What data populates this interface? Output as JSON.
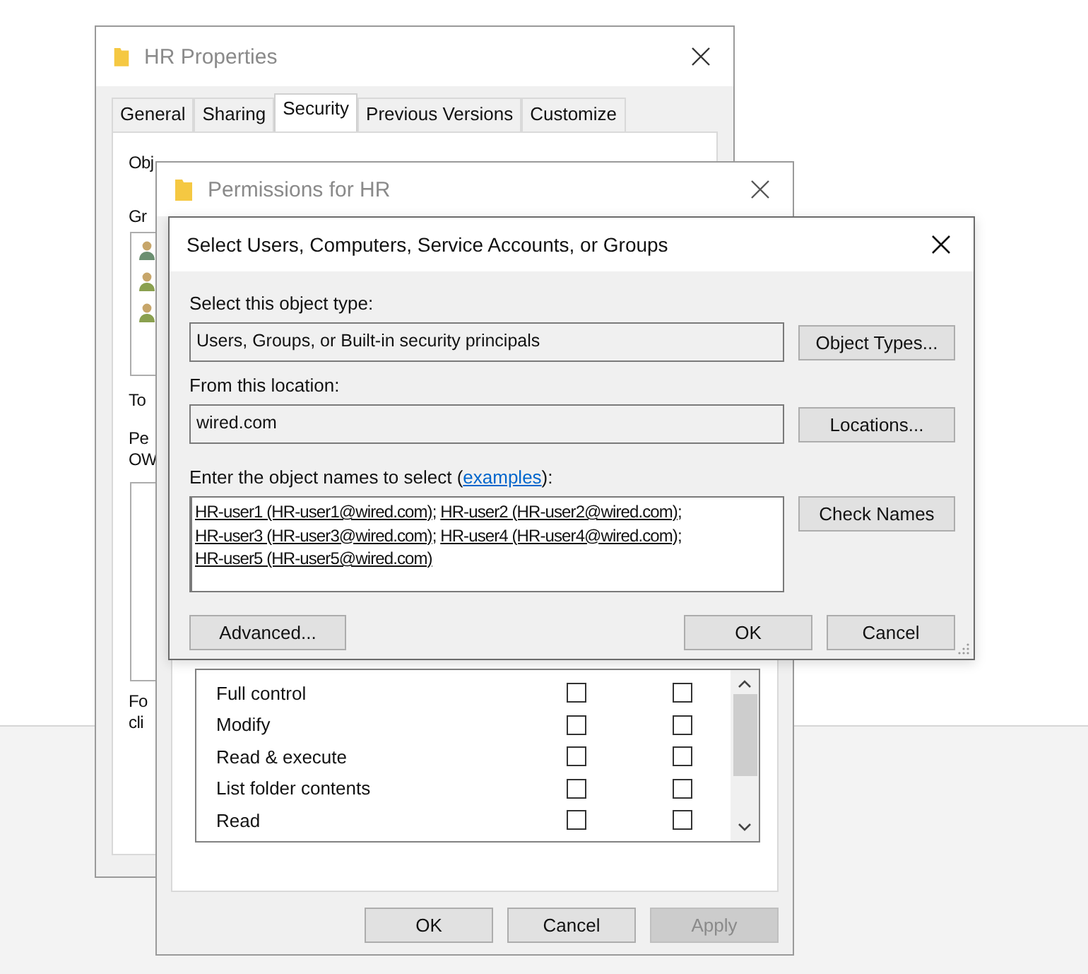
{
  "properties_window": {
    "title": "HR Properties",
    "tabs": [
      {
        "label": "General",
        "selected": false
      },
      {
        "label": "Sharing",
        "selected": false
      },
      {
        "label": "Security",
        "selected": true
      },
      {
        "label": "Previous Versions",
        "selected": false
      },
      {
        "label": "Customize",
        "selected": false
      }
    ],
    "object_label": "Obj",
    "groups_label": "Gr",
    "to_label": "To",
    "perm_label_1": "Pe",
    "perm_label_2": "OW",
    "for_label_1": "Fo",
    "for_label_2": "cli"
  },
  "permissions_window": {
    "title": "Permissions for HR",
    "permissions": [
      {
        "name": "Full control",
        "allow_checked": false,
        "deny_checked": false
      },
      {
        "name": "Modify",
        "allow_checked": false,
        "deny_checked": false
      },
      {
        "name": "Read & execute",
        "allow_checked": false,
        "deny_checked": false
      },
      {
        "name": "List folder contents",
        "allow_checked": false,
        "deny_checked": false
      },
      {
        "name": "Read",
        "allow_checked": false,
        "deny_checked": false
      }
    ],
    "buttons": [
      {
        "label": "OK",
        "disabled": false
      },
      {
        "label": "Cancel",
        "disabled": false
      },
      {
        "label": "Apply",
        "disabled": true
      }
    ]
  },
  "select_dialog": {
    "title": "Select Users, Computers, Service Accounts, or Groups",
    "object_type_label": "Select this object type:",
    "object_type": "Users, Groups, or Built-in security principals",
    "object_types_button": "Object Types...",
    "location_label": "From this location:",
    "location": "wired.com",
    "locations_button": "Locations...",
    "names_label_before": "Enter the object names to select (",
    "names_label_link": "examples",
    "names_label_after": "):",
    "names": [
      "HR-user1 (HR-user1@wired.com)",
      "HR-user2 (HR-user2@wired.com)",
      "HR-user3 (HR-user3@wired.com)",
      "HR-user4 (HR-user4@wired.com)",
      "HR-user5 (HR-user5@wired.com)"
    ],
    "separator": ";",
    "check_names_button": "Check Names",
    "advanced_button": "Advanced...",
    "ok_button": "OK",
    "cancel_button": "Cancel"
  }
}
